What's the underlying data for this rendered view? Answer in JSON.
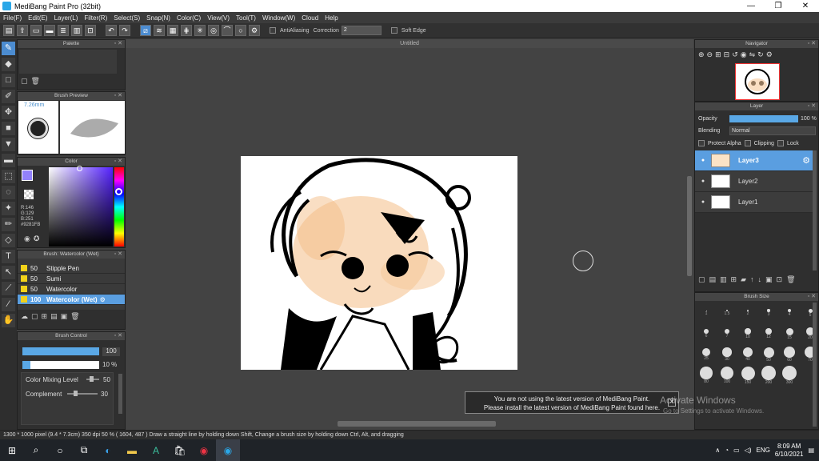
{
  "window": {
    "title": "MediBang Paint Pro (32bit)",
    "min": "—",
    "max": "❐",
    "close": "✕"
  },
  "menu": [
    "File(F)",
    "Edit(E)",
    "Layer(L)",
    "Filter(R)",
    "Select(S)",
    "Snap(N)",
    "Color(C)",
    "View(V)",
    "Tool(T)",
    "Window(W)",
    "Cloud",
    "Help"
  ],
  "toolbar": {
    "antialiasing": "AntiAliasing",
    "correction_label": "Correction",
    "correction_value": "2",
    "soft_edge": "Soft Edge"
  },
  "panels": {
    "palette": "Palette",
    "brush_preview": {
      "title": "Brush Preview",
      "size": "7.26mm"
    },
    "color": {
      "title": "Color",
      "r": "R:146",
      "g": "G:129",
      "b": "B:251",
      "hex": "#9281FB",
      "main": "#9281fb"
    },
    "brush_list": {
      "title": "Brush: Watercolor (Wet)",
      "items": [
        {
          "size": "50",
          "name": "Stipple Pen"
        },
        {
          "size": "50",
          "name": "Sumi"
        },
        {
          "size": "50",
          "name": "Watercolor"
        },
        {
          "size": "100",
          "name": "Watercolor (Wet)"
        }
      ]
    },
    "brush_control": {
      "title": "Brush Control",
      "size": "100",
      "opacity": "10 %",
      "mixing_label": "Color Mixing Level",
      "mixing_value": "50",
      "complement_label": "Complement",
      "complement_value": "30"
    },
    "navigator": "Navigator",
    "layer": {
      "title": "Layer",
      "opacity_label": "Opacity",
      "opacity_value": "100 %",
      "blending_label": "Blending",
      "blending_value": "Normal",
      "protect_alpha": "Protect Alpha",
      "clipping": "Clipping",
      "lock": "Lock",
      "layers": [
        "Layer3",
        "Layer2",
        "Layer1"
      ]
    },
    "brush_size": {
      "title": "Brush Size",
      "labels": [
        "1",
        "1.5",
        "2",
        "3",
        "4",
        "5",
        "6",
        "7",
        "10",
        "12",
        "15",
        "20",
        "25",
        "30",
        "40",
        "50",
        "60",
        "70",
        "80",
        "100",
        "150",
        "200",
        "300"
      ]
    }
  },
  "canvas": {
    "tab": "Untitled"
  },
  "notice": {
    "line1": "You are not using the latest version of MediBang Paint.",
    "line2": "Please install the latest version of MediBang Paint found here.",
    "watermark1": "Activate Windows",
    "watermark2": "Go to Settings to activate Windows."
  },
  "status": "1300 * 1000 pixel   (9.4 * 7.3cm)   350 dpi   50 %   ( 1604, 487 )   Draw a straight line by holding down Shift, Change a brush size by holding down Ctrl, Alt, and dragging",
  "taskbar": {
    "lang": "ENG",
    "time": "8:09 AM",
    "date": "6/10/2021"
  }
}
